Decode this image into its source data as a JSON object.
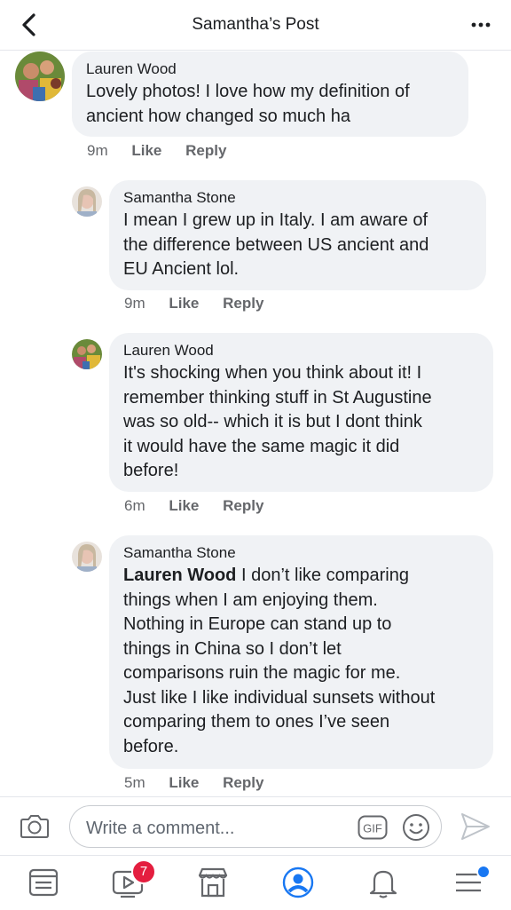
{
  "header": {
    "title": "Samantha’s Post"
  },
  "comments": [
    {
      "author": "Lauren Wood",
      "text": "Lovely photos! I love how my definition of\nancient how changed so much ha",
      "time": "9m",
      "like": "Like",
      "reply": "Reply"
    },
    {
      "author": "Samantha Stone",
      "text": "I mean I grew up in Italy. I am aware of\nthe difference between US ancient and\nEU Ancient lol.",
      "time": "9m",
      "like": "Like",
      "reply": "Reply"
    },
    {
      "author": "Lauren Wood",
      "text": "It's shocking when you think about it! I\nremember thinking stuff in St Augustine\nwas so old-- which it is but I dont think\nit would have the same magic it did\nbefore!",
      "time": "6m",
      "like": "Like",
      "reply": "Reply"
    },
    {
      "author": "Samantha Stone",
      "mention": "Lauren Wood",
      "text": " I don’t like comparing\nthings when I am enjoying them.\nNothing in Europe can stand up to\nthings in China so I don’t let\ncomparisons ruin the magic for me.\nJust like I like individual sunsets without\ncomparing them to ones I’ve seen\nbefore.",
      "time": "5m",
      "like": "Like",
      "reply": "Reply"
    }
  ],
  "composer": {
    "placeholder": "Write a comment...",
    "gif_label": "GIF"
  },
  "nav": {
    "watch_badge": "7"
  },
  "colors": {
    "accent": "#1877f2",
    "badge": "#e41e3f",
    "bubble": "#f0f2f5",
    "meta": "#65676b"
  }
}
